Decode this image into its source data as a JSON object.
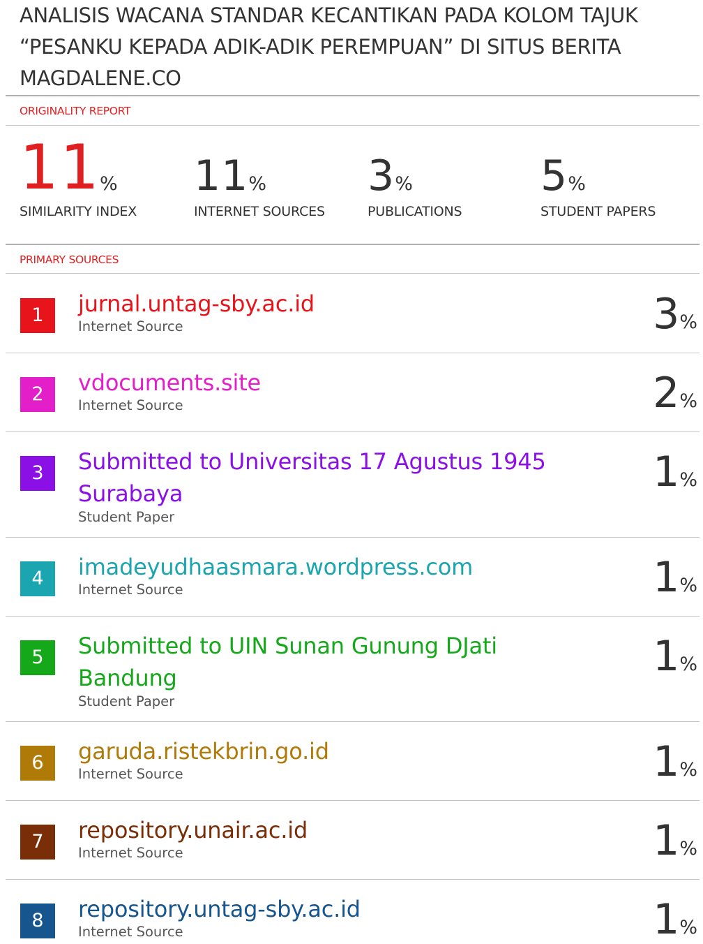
{
  "title": "ANALISIS WACANA STANDAR KECANTIKAN PADA KOLOM TAJUK “PESANKU KEPADA ADIK-ADIK PEREMPUAN” DI SITUS BERITA MAGDALENE.CO",
  "originality_label": "ORIGINALITY REPORT",
  "stats": [
    {
      "value": "11",
      "pct": "%",
      "label": "SIMILARITY INDEX"
    },
    {
      "value": "11",
      "pct": "%",
      "label": "INTERNET SOURCES"
    },
    {
      "value": "3",
      "pct": "%",
      "label": "PUBLICATIONS"
    },
    {
      "value": "5",
      "pct": "%",
      "label": "STUDENT PAPERS"
    }
  ],
  "primary_label": "PRIMARY SOURCES",
  "sources": [
    {
      "rank": "1",
      "name": "jurnal.untag-sby.ac.id",
      "type": "Internet Source",
      "pct": "3",
      "color": "#e8141b"
    },
    {
      "rank": "2",
      "name": "vdocuments.site",
      "type": "Internet Source",
      "pct": "2",
      "color": "#e21fc8"
    },
    {
      "rank": "3",
      "name": "Submitted to Universitas 17 Agustus 1945 Surabaya",
      "type": "Student Paper",
      "pct": "1",
      "color": "#8a10e6"
    },
    {
      "rank": "4",
      "name": "imadeyudhaasmara.wordpress.com",
      "type": "Internet Source",
      "pct": "1",
      "color": "#1aa5b0"
    },
    {
      "rank": "5",
      "name": "Submitted to UIN Sunan Gunung DJati Bandung",
      "type": "Student Paper",
      "pct": "1",
      "color": "#14a81a"
    },
    {
      "rank": "6",
      "name": "garuda.ristekbrin.go.id",
      "type": "Internet Source",
      "pct": "1",
      "color": "#b07a08"
    },
    {
      "rank": "7",
      "name": "repository.unair.ac.id",
      "type": "Internet Source",
      "pct": "1",
      "color": "#7a2e08"
    },
    {
      "rank": "8",
      "name": "repository.untag-sby.ac.id",
      "type": "Internet Source",
      "pct": "1",
      "color": "#16558e"
    }
  ]
}
